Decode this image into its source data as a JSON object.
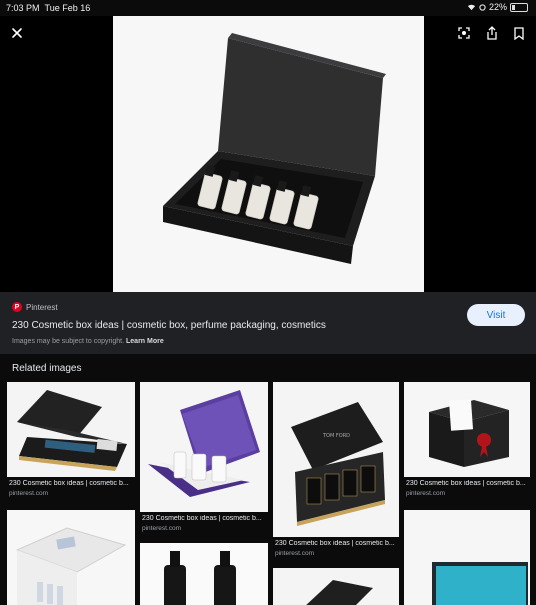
{
  "status": {
    "time": "7:03 PM",
    "date": "Tue Feb 16",
    "battery": "22%",
    "battery_level": 0.22
  },
  "viewer": {
    "close_icon": "close-icon",
    "actions": [
      "lens-icon",
      "share-icon",
      "bookmark-icon"
    ]
  },
  "result": {
    "source": "Pinterest",
    "title": "230 Cosmetic box ideas | cosmetic box, perfume packaging, cosmetics",
    "copyright": "Images may be subject to copyright.",
    "learn_more": "Learn More",
    "visit": "Visit"
  },
  "related": {
    "heading": "Related images",
    "items": [
      {
        "caption": "230 Cosmetic box ideas | cosmetic b...",
        "source": "pinterest.com"
      },
      {
        "caption": "230 Cosmetic box ideas | cosmetic b...",
        "source": "pinterest.com"
      },
      {
        "caption": "230 Cosmetic box ideas | cosmetic b...",
        "source": "pinterest.com"
      },
      {
        "caption": "230 Cosmetic box ideas | cosmetic b...",
        "source": "pinterest.com"
      }
    ]
  }
}
